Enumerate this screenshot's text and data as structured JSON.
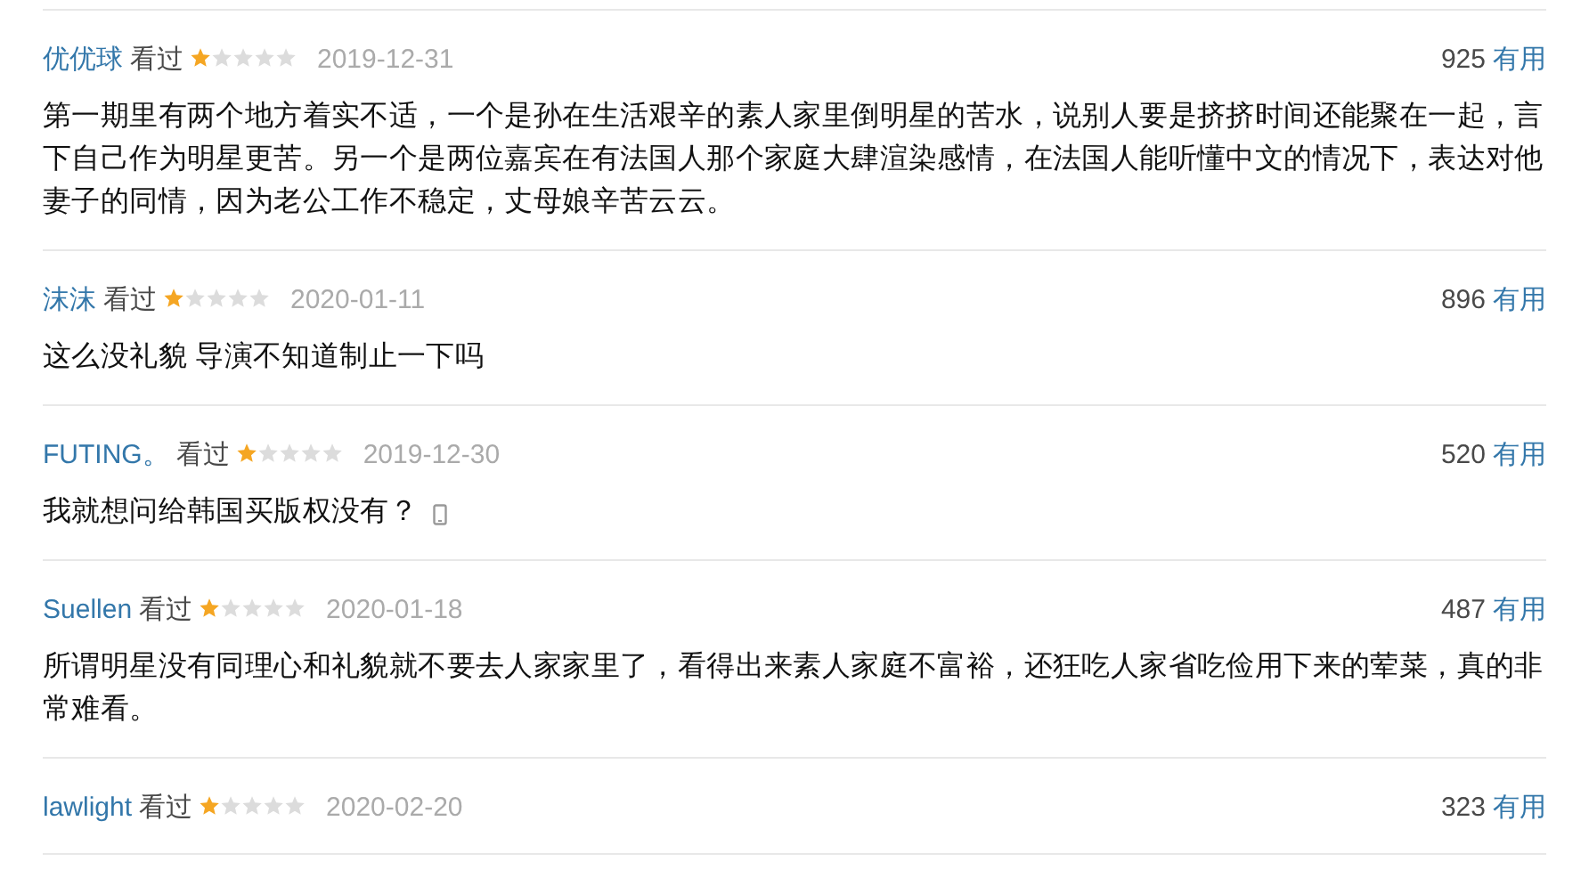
{
  "reviews": [
    {
      "user": "优优球",
      "status": "看过",
      "stars": 1,
      "date": "2019-12-31",
      "votes": "925",
      "vote_label": "有用",
      "text": "第一期里有两个地方着实不适，一个是孙在生活艰辛的素人家里倒明星的苦水，说别人要是挤挤时间还能聚在一起，言下自己作为明星更苦。另一个是两位嘉宾在有法国人那个家庭大肆渲染感情，在法国人能听懂中文的情况下，表达对他妻子的同情，因为老公工作不稳定，丈母娘辛苦云云。",
      "from_mobile": false
    },
    {
      "user": "沫沫",
      "status": "看过",
      "stars": 1,
      "date": "2020-01-11",
      "votes": "896",
      "vote_label": "有用",
      "text": "这么没礼貌 导演不知道制止一下吗",
      "from_mobile": false
    },
    {
      "user": "FUTING。",
      "status": "看过",
      "stars": 1,
      "date": "2019-12-30",
      "votes": "520",
      "vote_label": "有用",
      "text": "我就想问给韩国买版权没有？",
      "from_mobile": true
    },
    {
      "user": "Suellen",
      "status": "看过",
      "stars": 1,
      "date": "2020-01-18",
      "votes": "487",
      "vote_label": "有用",
      "text": "所谓明星没有同理心和礼貌就不要去人家家里了，看得出来素人家庭不富裕，还狂吃人家省吃俭用下来的荤菜，真的非常难看。",
      "from_mobile": false
    },
    {
      "user": "lawlight",
      "status": "看过",
      "stars": 1,
      "date": "2020-02-20",
      "votes": "323",
      "vote_label": "有用",
      "from_mobile": false
    }
  ]
}
